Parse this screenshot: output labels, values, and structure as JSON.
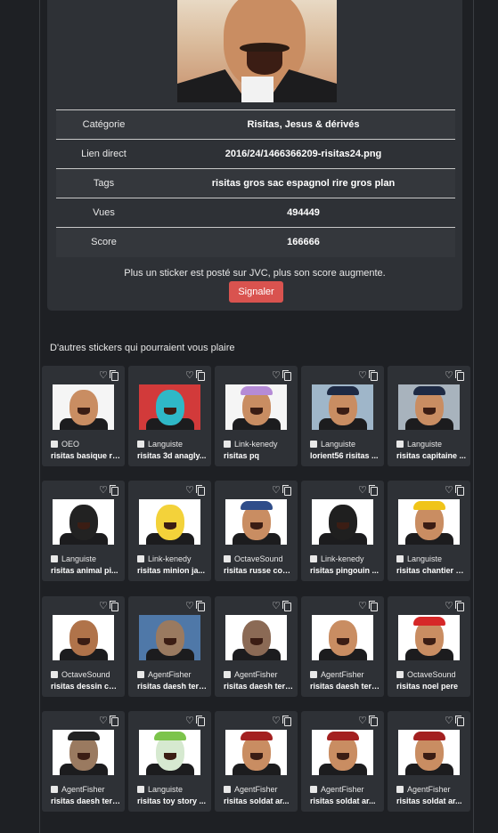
{
  "sticker": {
    "rows": [
      {
        "label": "Catégorie",
        "value": "Risitas, Jesus & dérivés"
      },
      {
        "label": "Lien direct",
        "value": "2016/24/1466366209-risitas24.png"
      },
      {
        "label": "Tags",
        "value": "risitas gros sac espagnol rire gros plan"
      },
      {
        "label": "Vues",
        "value": "494449"
      },
      {
        "label": "Score",
        "value": "166666"
      }
    ],
    "note": "Plus un sticker est posté sur JVC, plus son score augmente.",
    "report_label": "Signaler"
  },
  "related": {
    "title": "D'autres stickers qui pourraient vous plaire",
    "items": [
      {
        "user": "OEO",
        "name": "risitas basique ri..."
      },
      {
        "user": "Languiste",
        "name": "risitas 3d anagly..."
      },
      {
        "user": "Link-kenedy",
        "name": "risitas pq"
      },
      {
        "user": "Languiste",
        "name": "lorient56 risitas ..."
      },
      {
        "user": "Languiste",
        "name": "risitas capitaine ..."
      },
      {
        "user": "Languiste",
        "name": "risitas animal pi..."
      },
      {
        "user": "Link-kenedy",
        "name": "risitas minion ja..."
      },
      {
        "user": "OctaveSound",
        "name": "risitas russe com..."
      },
      {
        "user": "Link-kenedy",
        "name": "risitas pingouin ..."
      },
      {
        "user": "Languiste",
        "name": "risitas chantier c..."
      },
      {
        "user": "OctaveSound",
        "name": "risitas dessin car..."
      },
      {
        "user": "AgentFisher",
        "name": "risitas daesh terr..."
      },
      {
        "user": "AgentFisher",
        "name": "risitas daesh terr..."
      },
      {
        "user": "AgentFisher",
        "name": "risitas daesh terr..."
      },
      {
        "user": "OctaveSound",
        "name": "risitas noel pere"
      },
      {
        "user": "AgentFisher",
        "name": "risitas daesh terr..."
      },
      {
        "user": "Languiste",
        "name": "risitas toy story ..."
      },
      {
        "user": "AgentFisher",
        "name": "risitas soldat ar..."
      },
      {
        "user": "AgentFisher",
        "name": "risitas soldat ar..."
      },
      {
        "user": "AgentFisher",
        "name": "risitas soldat ar..."
      }
    ]
  },
  "icons": {
    "favorite": "heart-icon",
    "copy": "copy-icon",
    "user": "user-icon"
  },
  "colors": {
    "report_button": "#d9534f",
    "card": "#2e3136",
    "page": "#1e2024"
  }
}
